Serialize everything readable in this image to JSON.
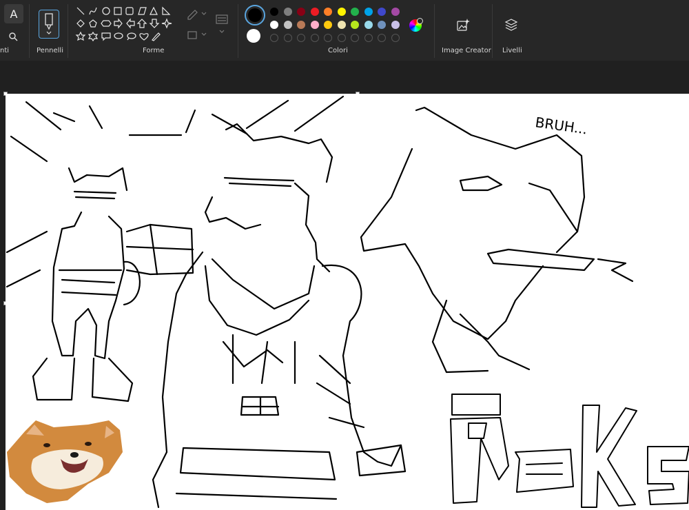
{
  "toolbar": {
    "groups": {
      "tools_partial": "nti",
      "brushes": "Pennelli",
      "shapes": "Forme",
      "colors": "Colori",
      "image_creator": "Image Creator",
      "layers": "Livelli"
    },
    "text_tool_glyph": "A"
  },
  "colors": {
    "primary": "#000000",
    "secondary": "#ffffff",
    "palette_row1": [
      "#000000",
      "#7f7f7f",
      "#880015",
      "#ed1c24",
      "#ff7f27",
      "#fff200",
      "#22b14c",
      "#00a2e8",
      "#3f48cc",
      "#a349a4"
    ],
    "palette_row2": [
      "#ffffff",
      "#c3c3c3",
      "#b97a57",
      "#ffaec9",
      "#ffc90e",
      "#efe4b0",
      "#b5e61d",
      "#99d9ea",
      "#7092be",
      "#c8bfe7"
    ]
  },
  "canvas": {
    "texts": {
      "bruh": "BRUH...",
      "reks": "ReKs"
    }
  }
}
